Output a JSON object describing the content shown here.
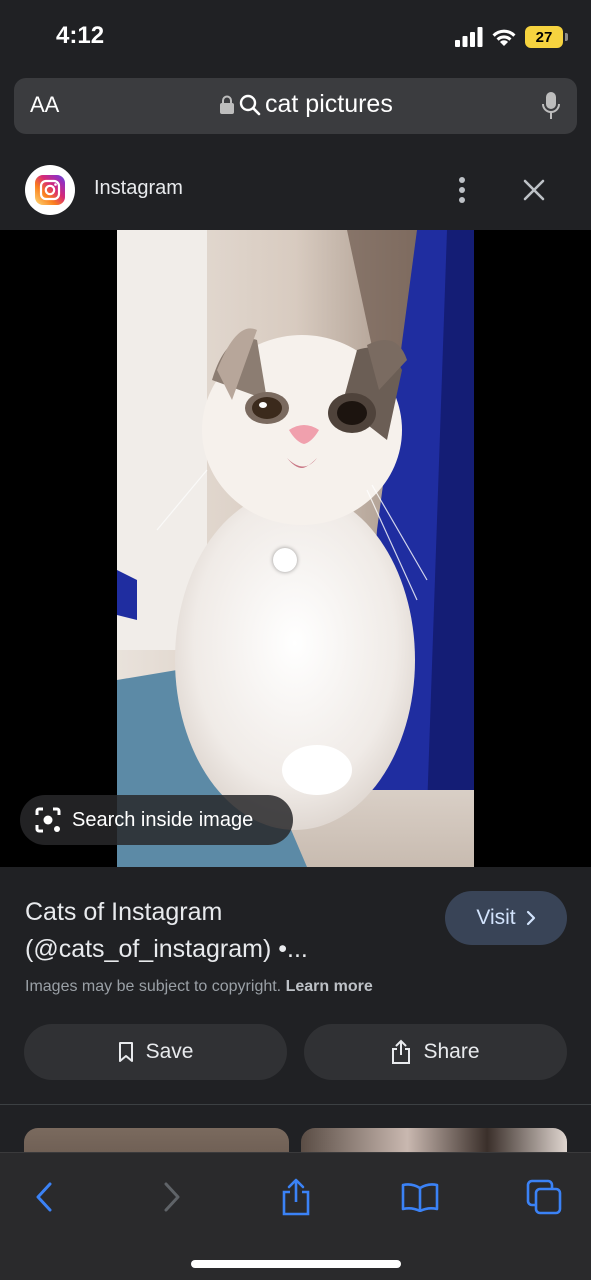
{
  "status_bar": {
    "time": "4:12",
    "battery": "27"
  },
  "address_bar": {
    "text_size_label": "AA",
    "url_text": "cat pictures"
  },
  "site": {
    "name": "Instagram"
  },
  "image": {
    "search_inside_label": "Search inside image"
  },
  "result": {
    "title_line1": "Cats of Instagram",
    "title_line2": "(@cats_of_instagram) •...",
    "visit_label": "Visit",
    "copyright_text": "Images may be subject to copyright.",
    "learn_more": "Learn more",
    "save_label": "Save",
    "share_label": "Share"
  },
  "colors": {
    "background": "#202124",
    "accent_blue": "#3b82f6",
    "visit_button": "#394457",
    "battery": "#f6d33f"
  },
  "toolbar": {
    "icons": [
      "back-icon",
      "forward-icon",
      "share-icon",
      "bookmarks-icon",
      "tabs-icon"
    ]
  }
}
